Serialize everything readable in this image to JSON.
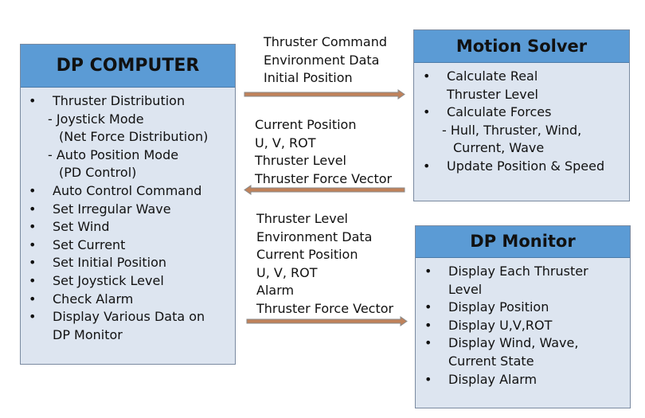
{
  "dp_computer": {
    "title": "DP COMPUTER",
    "items": [
      {
        "text": "Thruster Distribution",
        "bullet": true
      },
      {
        "text": "- Joystick Mode",
        "bullet": false,
        "indent": 1
      },
      {
        "text": "(Net Force Distribution)",
        "bullet": false,
        "indent": 2
      },
      {
        "text": "- Auto Position Mode",
        "bullet": false,
        "indent": 1
      },
      {
        "text": "(PD Control)",
        "bullet": false,
        "indent": 2
      },
      {
        "text": "Auto Control Command",
        "bullet": true
      },
      {
        "text": "Set Irregular Wave",
        "bullet": true
      },
      {
        "text": "Set Wind",
        "bullet": true
      },
      {
        "text": "Set Current",
        "bullet": true
      },
      {
        "text": "Set Initial Position",
        "bullet": true
      },
      {
        "text": "Set Joystick Level",
        "bullet": true
      },
      {
        "text": "Check Alarm",
        "bullet": true
      },
      {
        "text": "Display Various Data on",
        "bullet": true
      },
      {
        "text": "DP Monitor",
        "bullet": false,
        "indent": 0
      }
    ]
  },
  "motion_solver": {
    "title": "Motion Solver",
    "items": [
      {
        "text": "Calculate Real",
        "bullet": true
      },
      {
        "text": "Thruster Level",
        "bullet": false,
        "indent": 0
      },
      {
        "text": "Calculate Forces",
        "bullet": true
      },
      {
        "text": "- Hull, Thruster, Wind,",
        "bullet": false,
        "indent": 1
      },
      {
        "text": "Current, Wave",
        "bullet": false,
        "indent": 2
      },
      {
        "text": "Update Position & Speed",
        "bullet": true
      }
    ]
  },
  "dp_monitor": {
    "title": "DP Monitor",
    "items": [
      {
        "text": "Display Each Thruster",
        "bullet": true
      },
      {
        "text": "Level",
        "bullet": false,
        "indent": 0
      },
      {
        "text": "Display Position",
        "bullet": true
      },
      {
        "text": "Display U,V,ROT",
        "bullet": true
      },
      {
        "text": "Display Wind, Wave,",
        "bullet": true
      },
      {
        "text": "Current State",
        "bullet": false,
        "indent": 0
      },
      {
        "text": "Display Alarm",
        "bullet": true
      }
    ]
  },
  "flows": {
    "to_solver": "Thruster Command\nEnvironment Data\nInitial Position",
    "from_solver": "Current Position\nU, V, ROT\nThruster Level\nThruster Force Vector",
    "to_monitor": "Thruster Level\nEnvironment Data\nCurrent Position\nU, V, ROT\nAlarm\nThruster Force Vector"
  },
  "colors": {
    "header": "#5b9bd5",
    "body": "#dde5f0",
    "arrow": "#c0825a"
  }
}
